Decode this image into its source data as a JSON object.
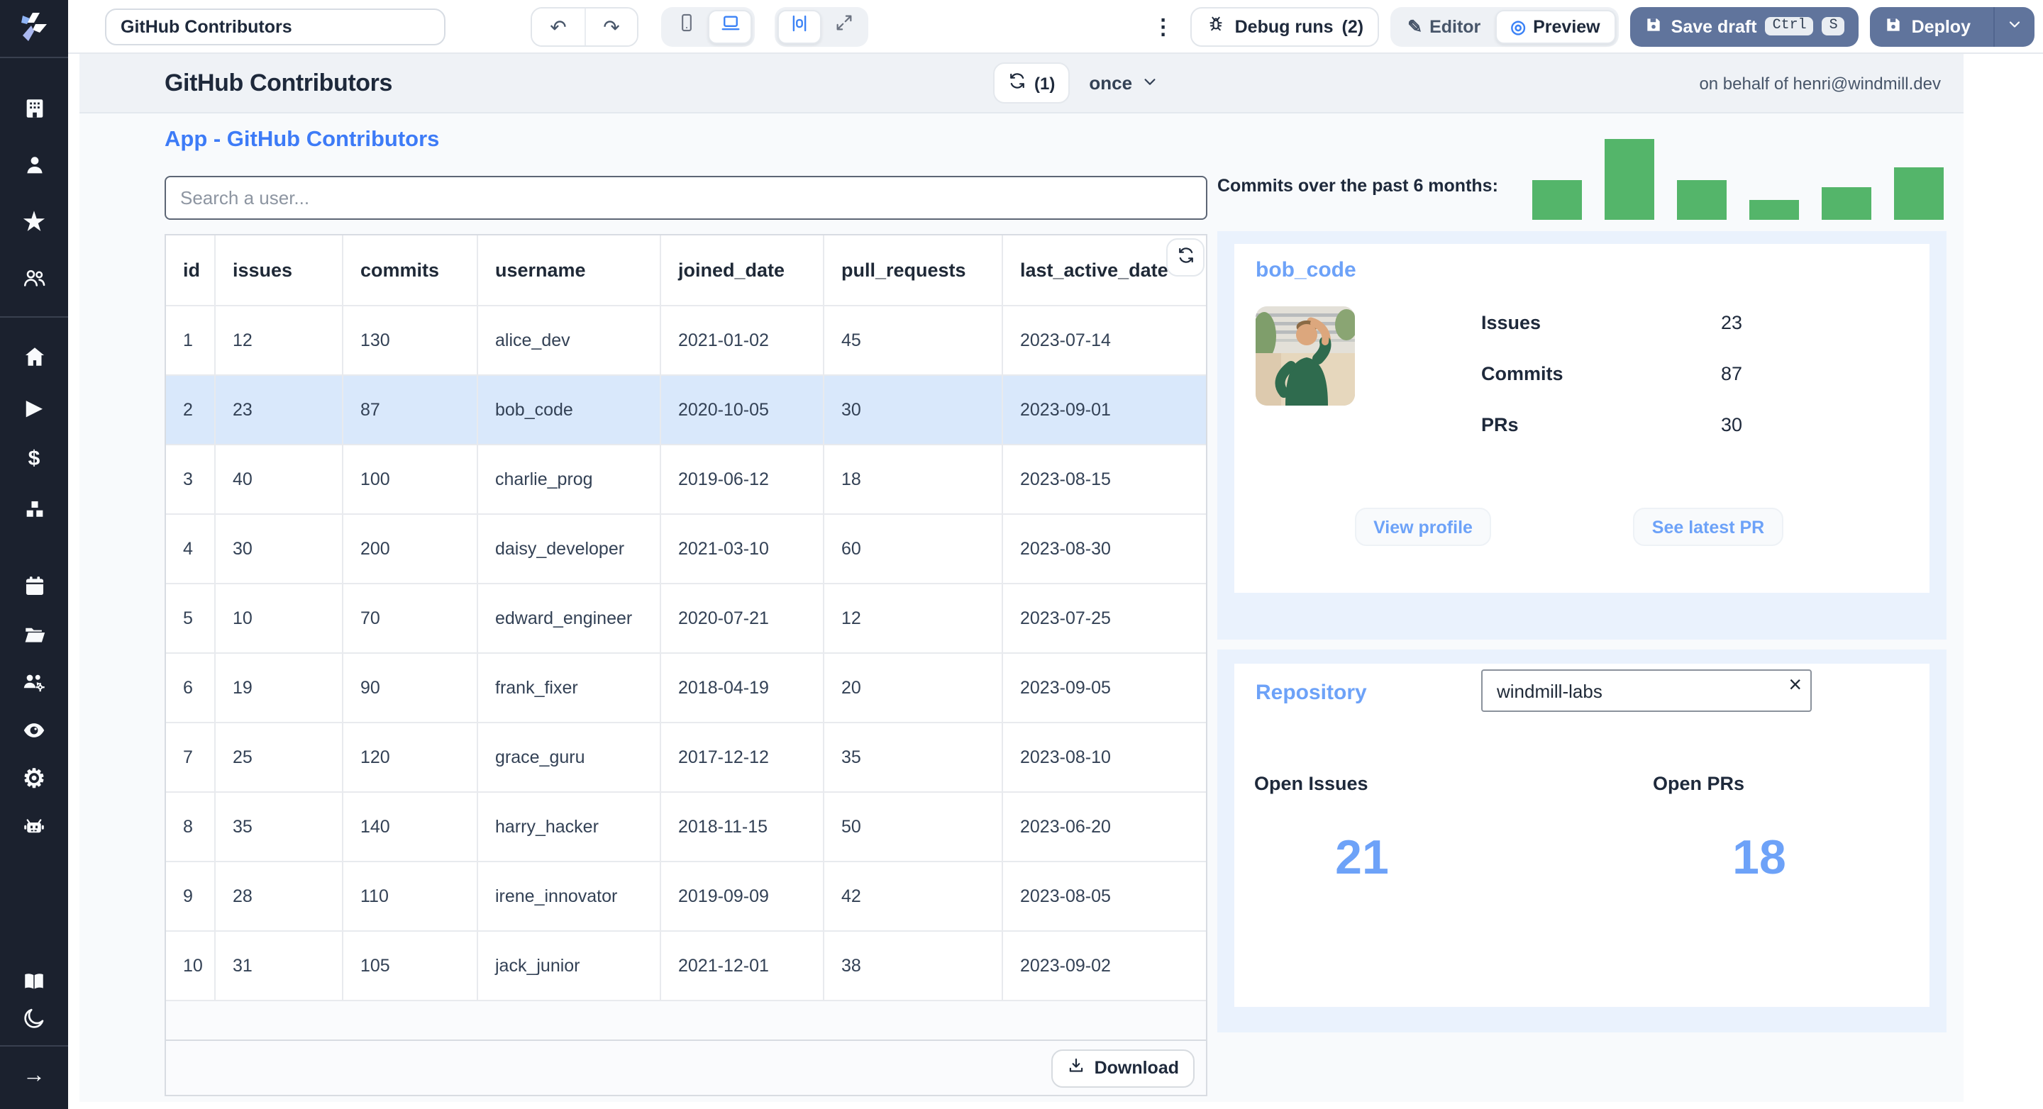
{
  "toolbar": {
    "app_name_input": "GitHub Contributors",
    "undo_glyph": "↶",
    "redo_glyph": "↷",
    "kebab_glyph": "⋮",
    "debug_runs_label": "Debug runs",
    "debug_runs_count": "(2)",
    "editor_label": "Editor",
    "editor_icon_glyph": "✎",
    "preview_label": "Preview",
    "preview_icon_glyph": "◎",
    "save_draft_label": "Save draft",
    "kbd_ctrl": "Ctrl",
    "kbd_s": "S",
    "deploy_label": "Deploy"
  },
  "sidebar": {
    "icons": [
      "windmill-logo",
      "workspace-building",
      "user",
      "star-favorites",
      "user-group",
      "home",
      "play-runs",
      "dollar-billing",
      "cubes-resources",
      "calendar-schedules",
      "folder",
      "users-settings",
      "eye-audit",
      "gear-settings",
      "robot-ai",
      "book-docs",
      "moon-dark-mode",
      "arrow-expand"
    ],
    "gear_glyph": "⚙",
    "dollar_glyph": "$",
    "star_glyph": "★",
    "play_glyph": "▶",
    "arrow_glyph": "→"
  },
  "app_header": {
    "title": "GitHub Contributors",
    "refresh_count": "(1)",
    "schedule_label": "once",
    "on_behalf_of": "on behalf of henri@windmill.dev"
  },
  "main": {
    "app_title": "App - GitHub Contributors",
    "search_placeholder": "Search a user...",
    "table": {
      "columns": [
        "id",
        "issues",
        "commits",
        "username",
        "joined_date",
        "pull_requests",
        "last_active_date"
      ],
      "rows": [
        [
          "1",
          "12",
          "130",
          "alice_dev",
          "2021-01-02",
          "45",
          "2023-07-14"
        ],
        [
          "2",
          "23",
          "87",
          "bob_code",
          "2020-10-05",
          "30",
          "2023-09-01"
        ],
        [
          "3",
          "40",
          "100",
          "charlie_prog",
          "2019-06-12",
          "18",
          "2023-08-15"
        ],
        [
          "4",
          "30",
          "200",
          "daisy_developer",
          "2021-03-10",
          "60",
          "2023-08-30"
        ],
        [
          "5",
          "10",
          "70",
          "edward_engineer",
          "2020-07-21",
          "12",
          "2023-07-25"
        ],
        [
          "6",
          "19",
          "90",
          "frank_fixer",
          "2018-04-19",
          "20",
          "2023-09-05"
        ],
        [
          "7",
          "25",
          "120",
          "grace_guru",
          "2017-12-12",
          "35",
          "2023-08-10"
        ],
        [
          "8",
          "35",
          "140",
          "harry_hacker",
          "2018-11-15",
          "50",
          "2023-06-20"
        ],
        [
          "9",
          "28",
          "110",
          "irene_innovator",
          "2019-09-09",
          "42",
          "2023-08-05"
        ],
        [
          "10",
          "31",
          "105",
          "jack_junior",
          "2021-12-01",
          "38",
          "2023-09-02"
        ]
      ],
      "selected_row_index": 1,
      "download_label": "Download"
    }
  },
  "chart_data": {
    "type": "bar",
    "title": "Commits over the past 6 months:",
    "values_pct": [
      49,
      100,
      49,
      25,
      41,
      65
    ],
    "bar_color": "#54b56a",
    "note": "six unlabeled bars, heights relative to tallest bar = 100"
  },
  "user_card": {
    "username": "bob_code",
    "stats": [
      {
        "label": "Issues",
        "value": "23"
      },
      {
        "label": "Commits",
        "value": "87"
      },
      {
        "label": "PRs",
        "value": "30"
      }
    ],
    "view_profile_label": "View profile",
    "see_latest_pr_label": "See latest PR"
  },
  "repo_card": {
    "title": "Repository",
    "input_value": "windmill-labs",
    "clear_glyph": "×",
    "open_issues_label": "Open Issues",
    "open_issues_value": "21",
    "open_prs_label": "Open PRs",
    "open_prs_value": "18"
  },
  "colors": {
    "sidebar_bg": "#1b212e",
    "canvas_bg": "#f8fafc",
    "header_bar_bg": "#eff2f6",
    "panel_blue": "#eaf2fd",
    "selected_row": "#d9e8fb",
    "accent_blue": "#3d7bf7",
    "light_blue_text": "#6da2f8",
    "bar_green": "#54b56a",
    "slate_button": "#60749c"
  }
}
